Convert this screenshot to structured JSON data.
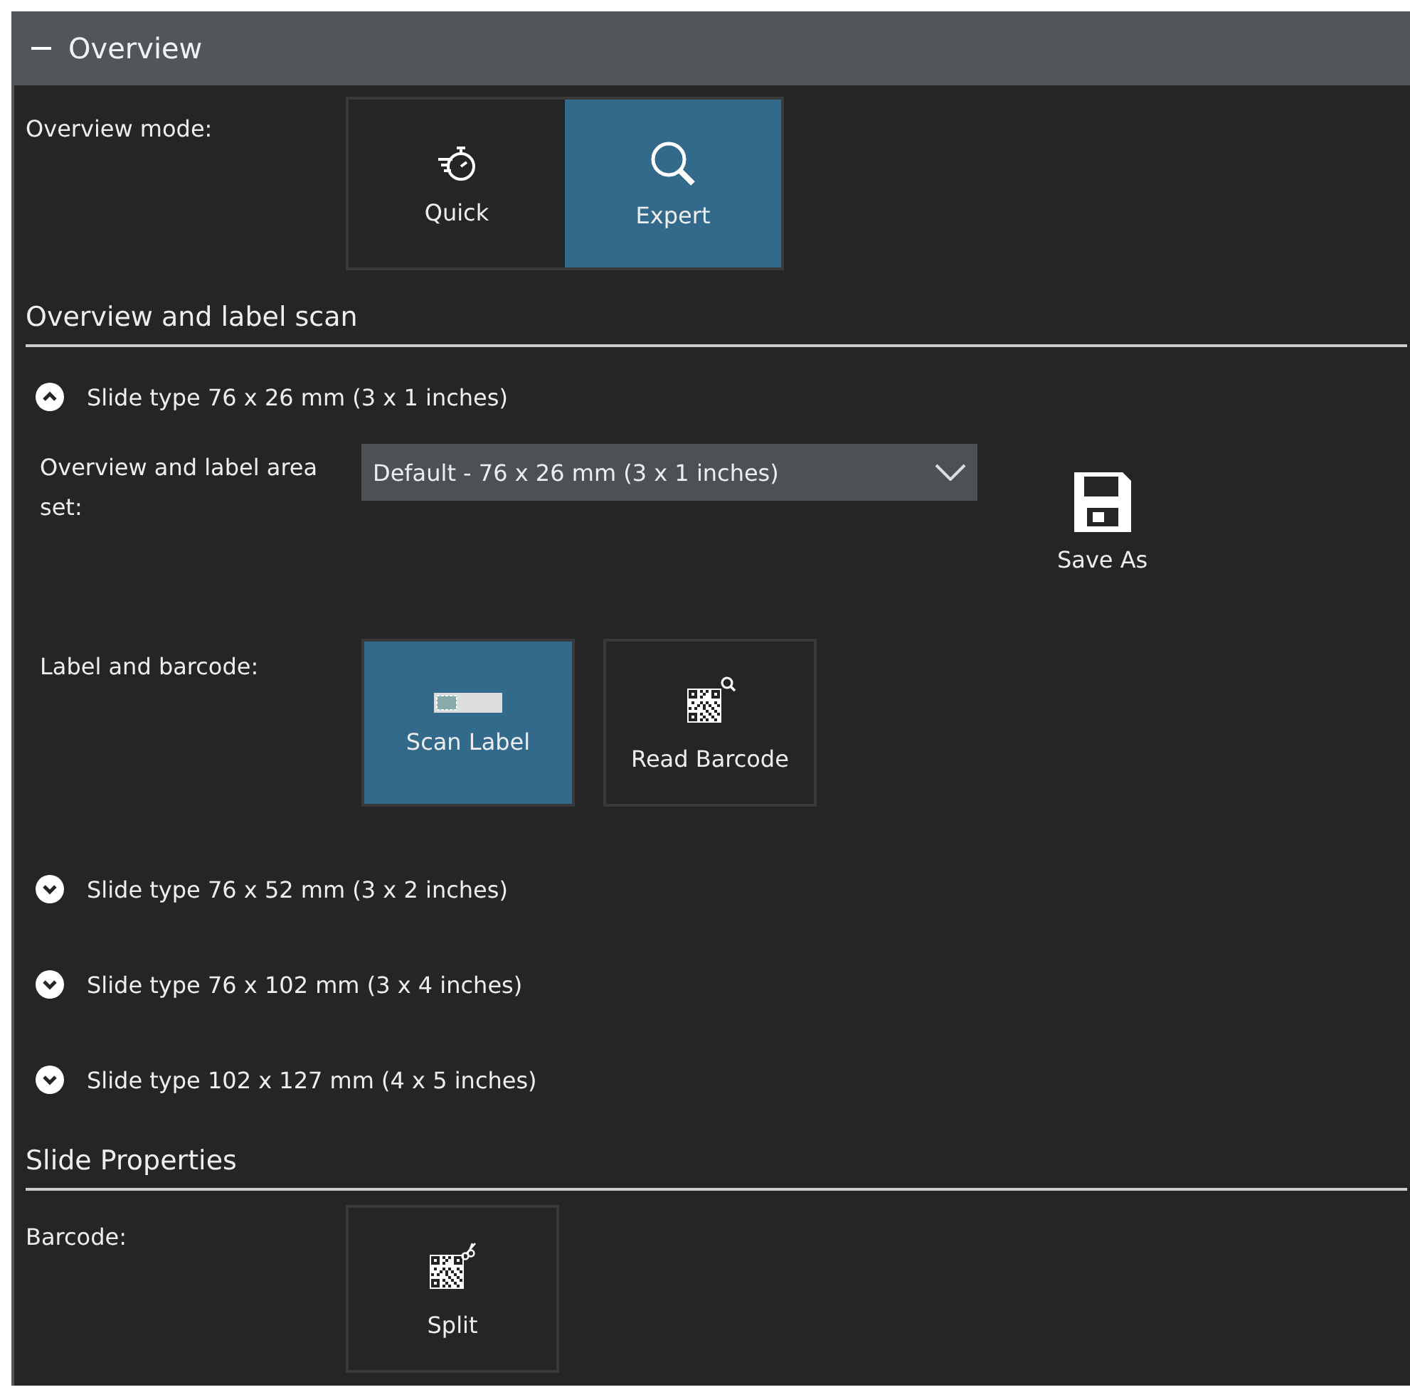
{
  "panel": {
    "title": "Overview",
    "expanded": true
  },
  "overview_mode": {
    "label": "Overview mode:",
    "options": [
      {
        "kind": "quick",
        "label": "Quick",
        "selected": false
      },
      {
        "kind": "expert",
        "label": "Expert",
        "selected": true
      }
    ]
  },
  "overview_and_label_scan": {
    "title": "Overview and label scan",
    "slide_types": [
      {
        "label": "Slide type 76 x 26 mm (3 x 1 inches)",
        "expanded": true,
        "area_set": {
          "label": "Overview and label area set:",
          "value": "Default - 76 x 26 mm (3 x 1 inches)"
        },
        "save_as": "Save As",
        "label_and_barcode": {
          "label": "Label and barcode:",
          "options": [
            {
              "kind": "scan_label",
              "label": "Scan Label",
              "selected": true
            },
            {
              "kind": "read_barcode",
              "label": "Read Barcode",
              "selected": false
            }
          ]
        }
      },
      {
        "label": "Slide type 76 x 52 mm (3 x 2 inches)",
        "expanded": false
      },
      {
        "label": "Slide type 76 x 102 mm (3 x 4 inches)",
        "expanded": false
      },
      {
        "label": "Slide type 102 x 127 mm (4 x 5 inches)",
        "expanded": false
      }
    ]
  },
  "slide_properties": {
    "title": "Slide Properties",
    "barcode": {
      "label": "Barcode:",
      "options": [
        {
          "kind": "split",
          "label": "Split",
          "selected": false
        }
      ]
    }
  }
}
